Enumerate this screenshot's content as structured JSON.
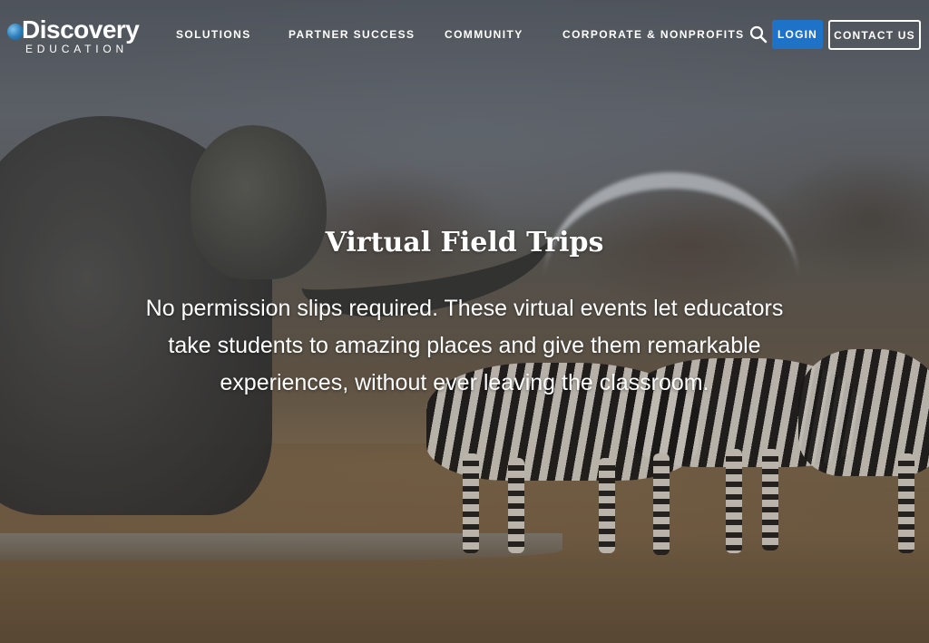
{
  "brand": {
    "logo_top": "Discovery",
    "logo_bottom": "EDUCATION"
  },
  "nav": {
    "items": [
      {
        "label": "SOLUTIONS"
      },
      {
        "label": "PARTNER SUCCESS"
      },
      {
        "label": "COMMUNITY"
      },
      {
        "label": "CORPORATE & NONPROFITS"
      }
    ],
    "search_icon": "search-icon",
    "login_label": "LOGIN",
    "contact_label": "CONTACT US"
  },
  "hero": {
    "title": "Virtual Field Trips",
    "description": "No permission slips required. These virtual events let educators take students to amazing places and give them remarkable experiences, without ever leaving the classroom."
  },
  "colors": {
    "accent_blue": "#1e73c8",
    "text_white": "#ffffff"
  }
}
